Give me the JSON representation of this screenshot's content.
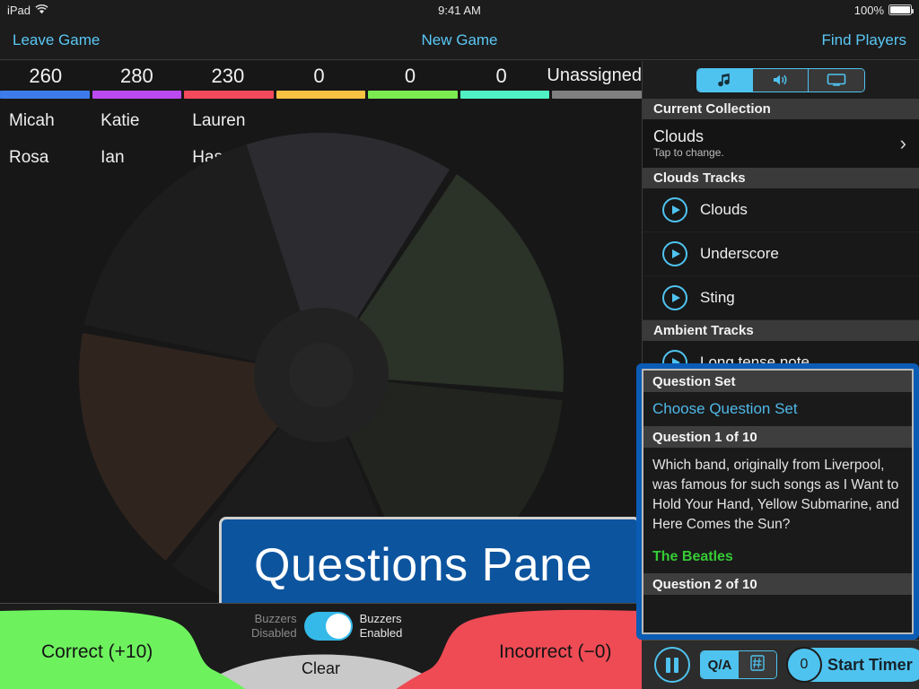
{
  "status_bar": {
    "device": "iPad",
    "wifi_icon": "wifi-icon",
    "time": "9:41 AM",
    "battery_percent": "100%"
  },
  "nav_bar": {
    "leave_game": "Leave Game",
    "title": "New Game",
    "find_players": "Find Players"
  },
  "scoreboard": {
    "columns": [
      {
        "score": "260",
        "color": "#3d7bea",
        "players": [
          "Micah",
          "Rosa"
        ]
      },
      {
        "score": "280",
        "color": "#bb4af0",
        "players": [
          "Katie",
          "Ian"
        ]
      },
      {
        "score": "230",
        "color": "#f2495c",
        "players": [
          "Lauren",
          "Hassan"
        ]
      },
      {
        "score": "0",
        "color": "#f7c142",
        "players": [
          "",
          ""
        ]
      },
      {
        "score": "0",
        "color": "#7ceb52",
        "players": [
          "",
          ""
        ]
      },
      {
        "score": "0",
        "color": "#4ff0c4",
        "players": [
          "",
          ""
        ]
      },
      {
        "score": "Unassigned",
        "color": "#808080",
        "players": [
          "",
          ""
        ]
      }
    ]
  },
  "callout": {
    "label": "Questions Pane"
  },
  "bottom_bar": {
    "correct_label": "Correct (+10)",
    "incorrect_label": "Incorrect (−0)",
    "clear_label": "Clear",
    "toggle_off_line1": "Buzzers",
    "toggle_off_line2": "Disabled",
    "toggle_on_line1": "Buzzers",
    "toggle_on_line2": "Enabled",
    "toggle_state": "on",
    "correct_color": "#6df25e",
    "incorrect_color": "#ef4b55",
    "clear_color": "#c9c9c9"
  },
  "right_panel": {
    "segmented": [
      {
        "icon": "music-note-icon",
        "active": true
      },
      {
        "icon": "speaker-icon",
        "active": false
      },
      {
        "icon": "display-icon",
        "active": false
      }
    ],
    "current_collection_header": "Current Collection",
    "collection_name": "Clouds",
    "collection_sub": "Tap to change.",
    "tracks_header": "Clouds Tracks",
    "tracks": [
      "Clouds",
      "Underscore",
      "Sting"
    ],
    "ambient_header": "Ambient Tracks",
    "ambient_tracks": [
      "Long tense note"
    ]
  },
  "questions_popup": {
    "set_header": "Question Set",
    "choose_label": "Choose Question Set",
    "question_header": "Question 1 of 10",
    "question_text": "Which band, originally from Liverpool, was famous for such songs as I Want to Hold Your Hand, Yellow Submarine, and Here Comes the Sun?",
    "answer_text": "The Beatles",
    "next_header": "Question 2 of 10"
  },
  "right_toolbar": {
    "pause_icon": "pause-icon",
    "qa_label": "Q/A",
    "numpad_icon": "numpad-icon",
    "timer_count": "0",
    "timer_label": "Start Timer"
  },
  "accent_color": "#4fc3ef"
}
